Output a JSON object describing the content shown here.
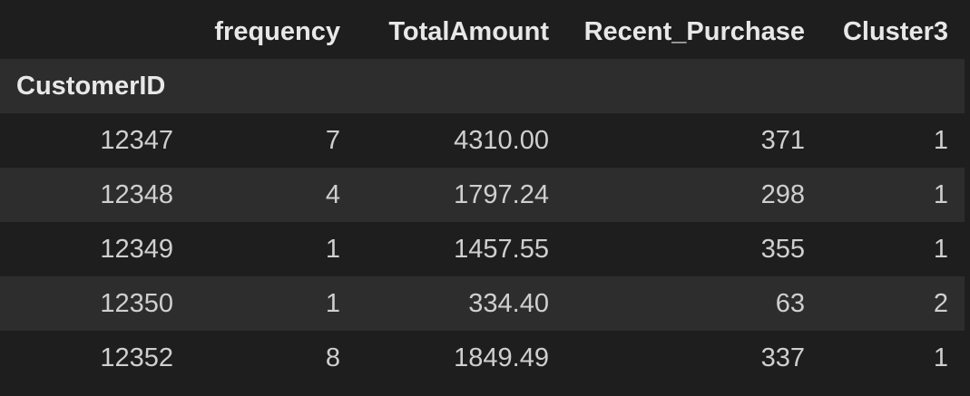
{
  "table": {
    "columns": [
      "frequency",
      "TotalAmount",
      "Recent_Purchase",
      "Cluster3"
    ],
    "index_name": "CustomerID",
    "rows": [
      {
        "index": "12347",
        "cells": [
          "7",
          "4310.00",
          "371",
          "1"
        ]
      },
      {
        "index": "12348",
        "cells": [
          "4",
          "1797.24",
          "298",
          "1"
        ]
      },
      {
        "index": "12349",
        "cells": [
          "1",
          "1457.55",
          "355",
          "1"
        ]
      },
      {
        "index": "12350",
        "cells": [
          "1",
          "334.40",
          "63",
          "2"
        ]
      },
      {
        "index": "12352",
        "cells": [
          "8",
          "1849.49",
          "337",
          "1"
        ]
      }
    ]
  },
  "colors": {
    "background": "#1e1e1e",
    "stripe": "#2d2d2d",
    "text": "#d4d4d4"
  }
}
